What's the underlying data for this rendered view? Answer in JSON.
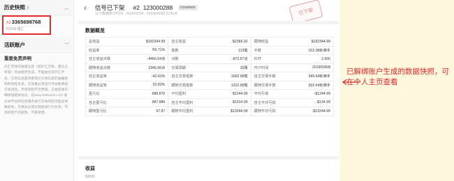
{
  "sidebar": {
    "history_title": "历史快照",
    "history_count": "3",
    "account": {
      "prefix": "#2",
      "number": "3365698768",
      "server": "FXCM 福汇"
    },
    "active_title": "活跃账户",
    "disclaimer_title": "重要免责声明",
    "disclaimer_text": "外汇市场的报道信息（如外汇交易、量化分析等）均由程序生成，不是由任何外汇平台、交易信息提供者或对交易信息的准确性和时效性负责。交易者必须自行评估和承担交易风险。市场风险不可预测。交易前请仔细阅读相关协议，在www.followme.com 通过本平台的任何服务进行交易风险可能会导致损失，交易员必须对其投资行为负责，市场风险不可避免，不要贪婪。"
  },
  "header": {
    "back_icon": "chevron-left-icon",
    "status": "信号已下架",
    "id_prefix": "#2",
    "id": "123000288",
    "badge": "icmarkets",
    "subtitle": "以下数据统计时间 · 2019/06/08 - 2019/06/08/ GTB+8",
    "stamp": "已下架"
  },
  "overview": {
    "title": "数据概览",
    "rows": [
      [
        {
          "label": "总收益",
          "value": "$192344.99"
        },
        {
          "label": "自主收益",
          "value": "$2366.02"
        },
        {
          "label": "跟随收益",
          "value": "$192344.99"
        }
      ],
      [
        {
          "label": "收益率",
          "value": "®0.71%"
        },
        {
          "label": "笔数",
          "value": "113笔"
        },
        {
          "label": "手数",
          "value": "102.38标准手"
        }
      ],
      [
        {
          "label": "自主收益点数",
          "value": "-4456.64点"
        },
        {
          "label": "点数",
          "value": "-872.97点"
        },
        {
          "label": "杠杆",
          "value": "1:500"
        }
      ],
      [
        {
          "label": "跟随收益点数",
          "value": "2345.66点"
        },
        {
          "label": "交易周期",
          "value": "33周"
        },
        {
          "label": "开户时间",
          "value": "2019/03/08"
        }
      ],
      [
        {
          "label": "自主收益率",
          "value": "-42.63%"
        },
        {
          "label": "自主交易笔数",
          "value": "1062.98笔"
        },
        {
          "label": "自主交易手数",
          "value": "345.64标准手"
        }
      ],
      [
        {
          "label": "跟随收益率",
          "value": "52.83%"
        },
        {
          "label": "跟随交易笔数",
          "value": "1322.98笔"
        },
        {
          "label": "跟随交易手数",
          "value": "355.64标准手"
        }
      ],
      [
        {
          "label": "盈亏比",
          "value": "988.876"
        },
        {
          "label": "平均盈利",
          "value": "$1244.99"
        },
        {
          "label": "平均亏损",
          "value": "-$1244.99"
        }
      ],
      [
        {
          "label": "自主盈亏比",
          "value": "987.986"
        },
        {
          "label": "自主平均盈利",
          "value": "$1314.99"
        },
        {
          "label": "自主平均亏损",
          "value": "-$134.99"
        }
      ],
      [
        {
          "label": "跟随盈亏比",
          "value": "97.97"
        },
        {
          "label": "跟随平均盈利",
          "value": "$13244.99"
        },
        {
          "label": "跟随平均亏损",
          "value": "-$13244.99"
        }
      ]
    ]
  },
  "chart": {
    "title": "收益",
    "y_tick": "$3000"
  },
  "annotation": {
    "text": "已解绑账户生成的数据快照，可在个人主页查看",
    "color": "#e0282a"
  },
  "colors": {
    "highlight_border": "#e52b2b",
    "annotation_bg": "#fdf7dd"
  }
}
